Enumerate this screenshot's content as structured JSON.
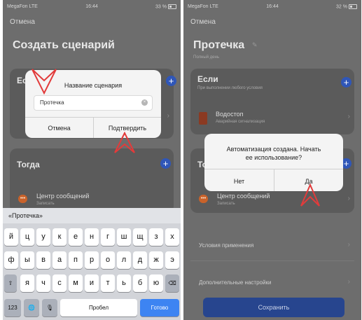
{
  "status_left": {
    "carrier": "MegaFon LTE",
    "time": "16:44",
    "battery": "33 %"
  },
  "status_right": {
    "carrier": "MegaFon LTE",
    "time": "16:44",
    "battery": "32 %"
  },
  "left": {
    "back": "Отмена",
    "title": "Создать сценарий",
    "if_section_initial": "Ес",
    "then_title": "Тогда",
    "then_item_name": "Центр сообщений",
    "then_item_sub": "Записать",
    "dialog": {
      "title": "Название сценария",
      "input_value": "Протечка",
      "cancel": "Отмена",
      "confirm": "Подтвердить"
    },
    "keyboard": {
      "suggestion": "«Протечка»",
      "row1": [
        "й",
        "ц",
        "у",
        "к",
        "е",
        "н",
        "г",
        "ш",
        "щ",
        "з",
        "х"
      ],
      "row2": [
        "ф",
        "ы",
        "в",
        "а",
        "п",
        "р",
        "о",
        "л",
        "д",
        "ж",
        "э"
      ],
      "row3": [
        "я",
        "ч",
        "с",
        "м",
        "и",
        "т",
        "ь",
        "б",
        "ю"
      ],
      "num_key": "123",
      "space": "Пробел",
      "done": "Готово",
      "shift_glyph": "⇧",
      "delete_glyph": "⌫",
      "globe_glyph": "🌐",
      "mic_glyph": "🎙"
    }
  },
  "right": {
    "back": "Отмена",
    "title": "Протечка",
    "subtitle": "Полный день",
    "if_title": "Если",
    "if_sub": "При выполнении любого условия",
    "if_item_name": "Водостоп",
    "if_item_sub": "Аварийная сигнализация",
    "then_initial": "То",
    "then_item_name": "Центр сообщений",
    "then_item_sub": "Записать",
    "conditions": "Условия применения",
    "extra": "Дополнительные настройки",
    "save": "Сохранить",
    "dialog": {
      "text_line1": "Автоматизация создана. Начать",
      "text_line2": "ее использование?",
      "no": "Нет",
      "yes": "Да"
    }
  },
  "icons": {
    "plus": "plus-icon",
    "chevron": "chevron-right-icon",
    "pencil": "pencil-icon",
    "clear": "clear-icon"
  },
  "colors": {
    "accent": "#3d84f2",
    "pointer": "#e23b3b",
    "save": "#27458e"
  }
}
